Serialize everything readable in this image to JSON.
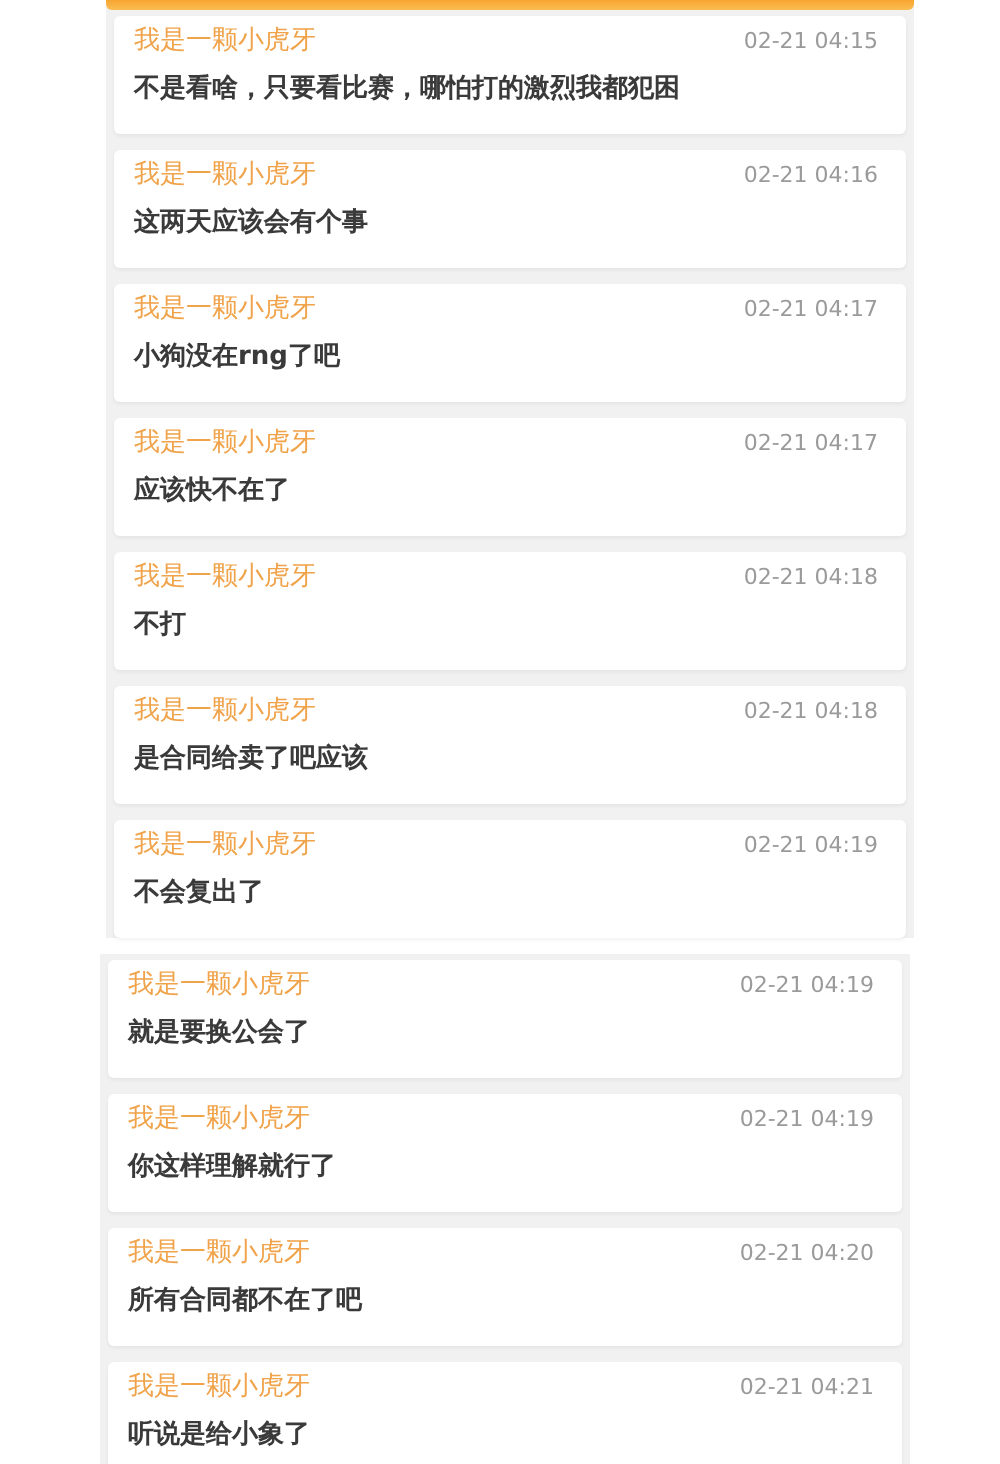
{
  "panels": [
    {
      "messages": [
        {
          "author": "我是一颗小虎牙",
          "time": "02-21 04:15",
          "text": "不是看啥，只要看比赛，哪怕打的激烈我都犯困"
        },
        {
          "author": "我是一颗小虎牙",
          "time": "02-21 04:16",
          "text": "这两天应该会有个事"
        },
        {
          "author": "我是一颗小虎牙",
          "time": "02-21 04:17",
          "text": "小狗没在rng了吧"
        },
        {
          "author": "我是一颗小虎牙",
          "time": "02-21 04:17",
          "text": "应该快不在了"
        },
        {
          "author": "我是一颗小虎牙",
          "time": "02-21 04:18",
          "text": "不打"
        },
        {
          "author": "我是一颗小虎牙",
          "time": "02-21 04:18",
          "text": "是合同给卖了吧应该"
        },
        {
          "author": "我是一颗小虎牙",
          "time": "02-21 04:19",
          "text": "不会复出了"
        }
      ]
    },
    {
      "messages": [
        {
          "author": "我是一颗小虎牙",
          "time": "02-21 04:19",
          "text": "就是要换公会了"
        },
        {
          "author": "我是一颗小虎牙",
          "time": "02-21 04:19",
          "text": "你这样理解就行了"
        },
        {
          "author": "我是一颗小虎牙",
          "time": "02-21 04:20",
          "text": "所有合同都不在了吧"
        },
        {
          "author": "我是一颗小虎牙",
          "time": "02-21 04:21",
          "text": "听说是给小象了"
        }
      ]
    }
  ]
}
